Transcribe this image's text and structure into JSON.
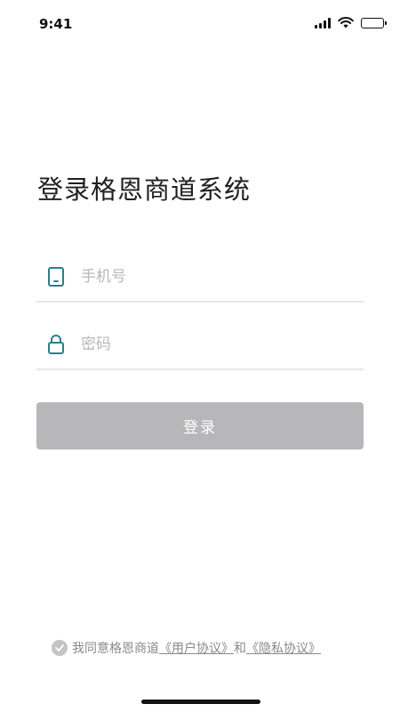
{
  "status_bar": {
    "time": "9:41",
    "icons": [
      "signal-icon",
      "wifi-icon",
      "battery-icon"
    ]
  },
  "title": "登录格恩商道系统",
  "form": {
    "phone": {
      "placeholder": "手机号",
      "value": "",
      "icon": "phone-icon"
    },
    "password": {
      "placeholder": "密码",
      "value": "",
      "icon": "lock-icon"
    },
    "login_label": "登录"
  },
  "agreement": {
    "prefix": "我同意格恩商道",
    "user_agreement": "《用户协议》",
    "and": "和",
    "privacy_policy": "《隐私协议》"
  },
  "colors": {
    "icon_accent": "#2a7f8c",
    "button_disabled": "#b7b7b9",
    "check_gray": "#c4c4c4"
  }
}
